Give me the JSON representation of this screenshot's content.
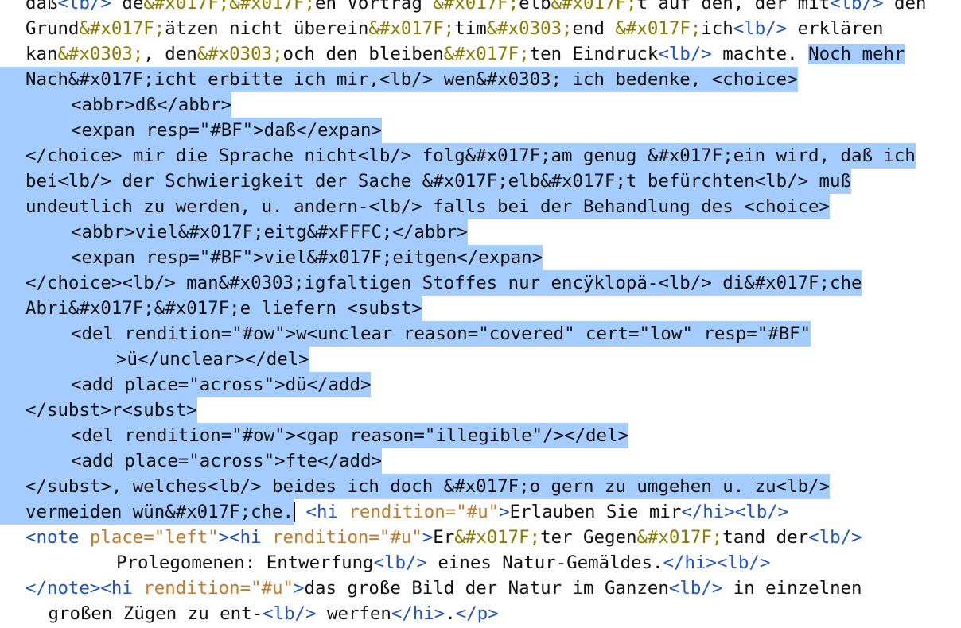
{
  "editor": {
    "lines": [
      {
        "indent": 0,
        "selected": false,
        "segments": [
          {
            "kind": "text",
            "t": "daß"
          },
          {
            "kind": "tag",
            "t": "<lb/>"
          },
          {
            "kind": "text",
            "t": " de"
          },
          {
            "kind": "ent",
            "t": "&#x017F;&#x017F;"
          },
          {
            "kind": "text",
            "t": "en Vortrag "
          },
          {
            "kind": "ent",
            "t": "&#x017F;"
          },
          {
            "kind": "text",
            "t": "elb"
          },
          {
            "kind": "ent",
            "t": "&#x017F;"
          },
          {
            "kind": "text",
            "t": "t auf den, der mit"
          },
          {
            "kind": "tag",
            "t": "<lb/>"
          },
          {
            "kind": "text",
            "t": " den"
          }
        ]
      },
      {
        "indent": 0,
        "selected": false,
        "segments": [
          {
            "kind": "text",
            "t": "Grund"
          },
          {
            "kind": "ent",
            "t": "&#x017F;"
          },
          {
            "kind": "text",
            "t": "ätzen nicht überein"
          },
          {
            "kind": "ent",
            "t": "&#x017F;"
          },
          {
            "kind": "text",
            "t": "tim"
          },
          {
            "kind": "ent",
            "t": "&#x0303;"
          },
          {
            "kind": "text",
            "t": "end "
          },
          {
            "kind": "ent",
            "t": "&#x017F;"
          },
          {
            "kind": "text",
            "t": "ich"
          },
          {
            "kind": "tag",
            "t": "<lb/>"
          },
          {
            "kind": "text",
            "t": " erklären"
          }
        ]
      },
      {
        "indent": 0,
        "selected": false,
        "partial_select": true,
        "segments": [
          {
            "kind": "text",
            "t": "kan"
          },
          {
            "kind": "ent",
            "t": "&#x0303;"
          },
          {
            "kind": "text",
            "t": ", den"
          },
          {
            "kind": "ent",
            "t": "&#x0303;"
          },
          {
            "kind": "text",
            "t": "och den bleiben"
          },
          {
            "kind": "ent",
            "t": "&#x017F;"
          },
          {
            "kind": "text",
            "t": "ten Eindruck"
          },
          {
            "kind": "tag",
            "t": "<lb/>"
          },
          {
            "kind": "text",
            "t": " machte. "
          },
          {
            "kind": "sel",
            "t": "Noch mehr"
          }
        ]
      },
      {
        "indent": 0,
        "selected": true,
        "segments": [
          {
            "kind": "sel",
            "t": "Nach&#x017F;icht erbitte ich mir,<lb/> wen&#x0303; ich bedenke, <choice>"
          }
        ]
      },
      {
        "indent": 1,
        "selected": true,
        "segments": [
          {
            "kind": "sel",
            "t": "<abbr>dß</abbr>"
          }
        ]
      },
      {
        "indent": 1,
        "selected": true,
        "segments": [
          {
            "kind": "sel",
            "t": "<expan resp=\"#BF\">daß</expan>"
          }
        ]
      },
      {
        "indent": 0,
        "selected": true,
        "segments": [
          {
            "kind": "sel",
            "t": "</choice> mir die Sprache nicht<lb/> folg&#x017F;am genug &#x017F;ein wird, daß ich"
          }
        ]
      },
      {
        "indent": 0,
        "selected": true,
        "segments": [
          {
            "kind": "sel",
            "t": "bei<lb/> der Schwierigkeit der Sache &#x017F;elb&#x017F;t befürchten<lb/> muß"
          }
        ]
      },
      {
        "indent": 0,
        "selected": true,
        "segments": [
          {
            "kind": "sel",
            "t": "undeutlich zu werden, u. andern-<lb/> falls bei der Behandlung des <choice>"
          }
        ]
      },
      {
        "indent": 1,
        "selected": true,
        "segments": [
          {
            "kind": "sel",
            "t": "<abbr>viel&#x017F;eitg&#xFFFC;</abbr>"
          }
        ]
      },
      {
        "indent": 1,
        "selected": true,
        "segments": [
          {
            "kind": "sel",
            "t": "<expan resp=\"#BF\">viel&#x017F;eitgen</expan>"
          }
        ]
      },
      {
        "indent": 0,
        "selected": true,
        "segments": [
          {
            "kind": "sel",
            "t": "</choice><lb/> man&#x0303;igfaltigen Stoffes nur encÿklopä-<lb/> di&#x017F;che"
          }
        ]
      },
      {
        "indent": 0,
        "selected": true,
        "segments": [
          {
            "kind": "sel",
            "t": "Abri&#x017F;&#x017F;e liefern <subst>"
          }
        ]
      },
      {
        "indent": 1,
        "selected": true,
        "segments": [
          {
            "kind": "sel",
            "t": "<del rendition=\"#ow\">w<unclear reason=\"covered\" cert=\"low\" resp=\"#BF\""
          }
        ]
      },
      {
        "indent": 2,
        "selected": true,
        "segments": [
          {
            "kind": "sel",
            "t": ">ü</unclear></del>"
          }
        ]
      },
      {
        "indent": 1,
        "selected": true,
        "segments": [
          {
            "kind": "sel",
            "t": "<add place=\"across\">dü</add>"
          }
        ]
      },
      {
        "indent": 0,
        "selected": true,
        "segments": [
          {
            "kind": "sel",
            "t": "</subst>r<subst>"
          }
        ]
      },
      {
        "indent": 1,
        "selected": true,
        "segments": [
          {
            "kind": "sel",
            "t": "<del rendition=\"#ow\"><gap reason=\"illegible\"/></del>"
          }
        ]
      },
      {
        "indent": 1,
        "selected": true,
        "segments": [
          {
            "kind": "sel",
            "t": "<add place=\"across\">fte</add>"
          }
        ]
      },
      {
        "indent": 0,
        "selected": true,
        "segments": [
          {
            "kind": "sel",
            "t": "</subst>, welches<lb/> beides ich doch &#x017F;o gern zu umgehen u. zu<lb/>"
          }
        ]
      },
      {
        "indent": 0,
        "selected": true,
        "caret": true,
        "segments": [
          {
            "kind": "sel",
            "t": "vermeiden wün&#x017F;che."
          },
          {
            "kind": "caret",
            "t": ""
          },
          {
            "kind": "text",
            "t": " "
          },
          {
            "kind": "tag",
            "t": "<hi "
          },
          {
            "kind": "attr",
            "t": "rendition="
          },
          {
            "kind": "attr",
            "t": "\"#u\""
          },
          {
            "kind": "tag",
            "t": ">"
          },
          {
            "kind": "text",
            "t": "Erlauben Sie mir"
          },
          {
            "kind": "tag",
            "t": "</hi><lb/>"
          }
        ]
      },
      {
        "indent": 0,
        "selected": false,
        "segments": [
          {
            "kind": "tag",
            "t": "<note "
          },
          {
            "kind": "attr",
            "t": "place="
          },
          {
            "kind": "attr",
            "t": "\"left\""
          },
          {
            "kind": "tag",
            "t": "><hi "
          },
          {
            "kind": "attr",
            "t": "rendition="
          },
          {
            "kind": "attr",
            "t": "\"#u\""
          },
          {
            "kind": "tag",
            "t": ">"
          },
          {
            "kind": "text",
            "t": "Er"
          },
          {
            "kind": "ent",
            "t": "&#x017F;"
          },
          {
            "kind": "text",
            "t": "ter Gegen"
          },
          {
            "kind": "ent",
            "t": "&#x017F;"
          },
          {
            "kind": "text",
            "t": "tand der"
          },
          {
            "kind": "tag",
            "t": "<lb/>"
          }
        ]
      },
      {
        "indent": 2,
        "selected": false,
        "segments": [
          {
            "kind": "text",
            "t": "Prolegomenen: Entwerfung"
          },
          {
            "kind": "tag",
            "t": "<lb/>"
          },
          {
            "kind": "text",
            "t": " eines Natur-Gemäldes."
          },
          {
            "kind": "tag",
            "t": "</hi><lb/>"
          }
        ]
      },
      {
        "indent": 0,
        "selected": false,
        "segments": [
          {
            "kind": "tag",
            "t": "</note><hi "
          },
          {
            "kind": "attr",
            "t": "rendition="
          },
          {
            "kind": "attr",
            "t": "\"#u\""
          },
          {
            "kind": "tag",
            "t": ">"
          },
          {
            "kind": "text",
            "t": "das große Bild der Natur im Ganzen"
          },
          {
            "kind": "tag",
            "t": "<lb/>"
          },
          {
            "kind": "text",
            "t": " in einzelnen"
          }
        ]
      },
      {
        "indent": 0.5,
        "selected": false,
        "segments": [
          {
            "kind": "text",
            "t": "großen Zügen zu ent-"
          },
          {
            "kind": "tag",
            "t": "<lb/>"
          },
          {
            "kind": "text",
            "t": " werfen"
          },
          {
            "kind": "tag",
            "t": "</hi>"
          },
          {
            "kind": "text",
            "t": "."
          },
          {
            "kind": "tag",
            "t": "</p>"
          }
        ]
      }
    ]
  }
}
